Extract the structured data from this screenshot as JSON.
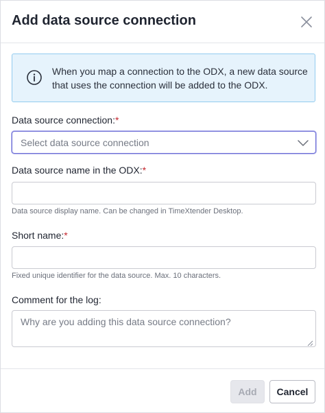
{
  "dialog": {
    "title": "Add data source connection"
  },
  "info": {
    "message": "When you map a connection to the ODX, a new data source that uses the connection will be added to the ODX."
  },
  "form": {
    "connection": {
      "label": "Data source connection:",
      "required_mark": "*",
      "placeholder": "Select data source connection"
    },
    "name": {
      "label": "Data source name in the ODX:",
      "required_mark": "*",
      "value": "",
      "hint": "Data source display name. Can be changed in TimeXtender Desktop."
    },
    "short_name": {
      "label": "Short name:",
      "required_mark": "*",
      "value": "",
      "hint": "Fixed unique identifier for the data source. Max. 10 characters."
    },
    "comment": {
      "label": "Comment for the log:",
      "placeholder": "Why are you adding this data source connection?"
    }
  },
  "footer": {
    "add_label": "Add",
    "cancel_label": "Cancel"
  },
  "icons": {
    "close": "close-icon",
    "info": "info-icon",
    "chevron": "chevron-down-icon"
  },
  "colors": {
    "info_background": "#e6f3fc",
    "info_border": "#92cbef",
    "focus_border": "#6e6fd6",
    "required": "#c4262e"
  }
}
